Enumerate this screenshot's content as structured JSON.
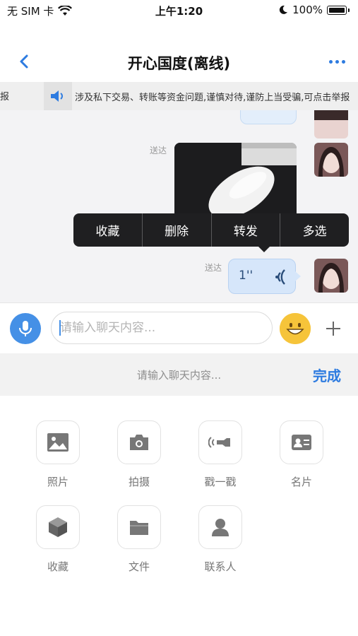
{
  "status_bar": {
    "carrier": "无 SIM 卡",
    "time": "上午1:20",
    "battery_percent": "100%"
  },
  "nav": {
    "title": "开心国度(离线)",
    "back_icon": "chevron-left-icon",
    "more_icon": "more-dots-icon",
    "accent_color": "#2d7be0"
  },
  "notice": {
    "left_fragment": "报",
    "text": "涉及私下交易、转账等资金问题,谨慎对待,谨防上当受骗,可点击举报"
  },
  "messages": {
    "image_status": "送达",
    "voice_status": "送达",
    "voice_duration": "1''"
  },
  "context_menu": {
    "items": [
      "收藏",
      "删除",
      "转发",
      "多选"
    ]
  },
  "input_bar": {
    "placeholder": "请输入聊天内容..."
  },
  "sub_row": {
    "placeholder": "请输入聊天内容...",
    "done_label": "完成"
  },
  "panel": {
    "items": [
      {
        "label": "照片",
        "icon": "photo-icon"
      },
      {
        "label": "拍摄",
        "icon": "camera-icon"
      },
      {
        "label": "戳一戳",
        "icon": "poke-icon"
      },
      {
        "label": "名片",
        "icon": "card-icon"
      },
      {
        "label": "收藏",
        "icon": "favorite-cube-icon"
      },
      {
        "label": "文件",
        "icon": "folder-icon"
      },
      {
        "label": "联系人",
        "icon": "contact-icon"
      }
    ]
  }
}
